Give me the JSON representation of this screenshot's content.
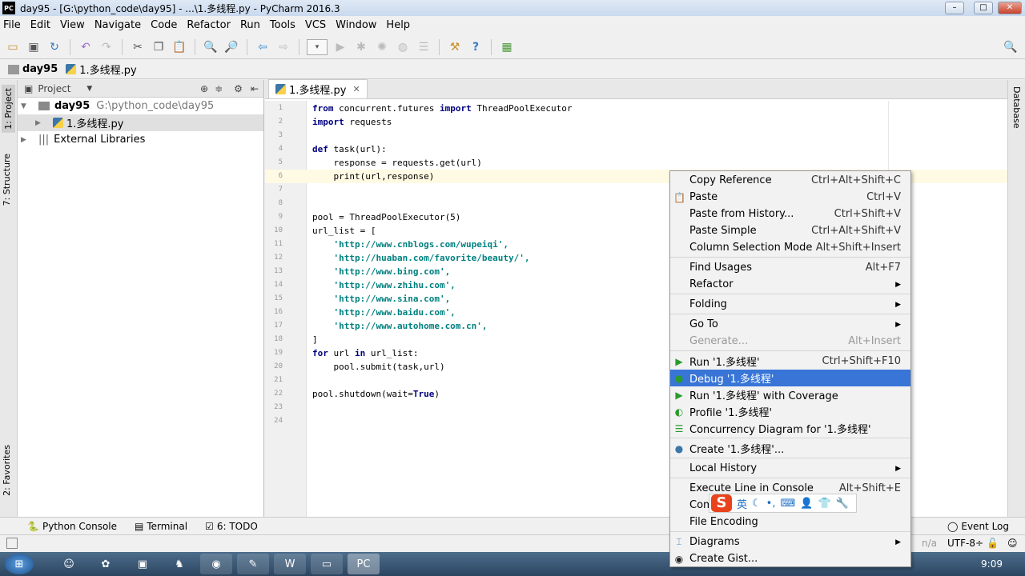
{
  "window": {
    "title": "day95 - [G:\\python_code\\day95] - ...\\1.多线程.py - PyCharm 2016.3",
    "logo": "PC",
    "controls": [
      "minimize",
      "maximize",
      "close"
    ]
  },
  "menubar": [
    "File",
    "Edit",
    "View",
    "Navigate",
    "Code",
    "Refactor",
    "Run",
    "Tools",
    "VCS",
    "Window",
    "Help"
  ],
  "toolbar_icons": [
    "open-folder",
    "save",
    "sync",
    "undo",
    "redo",
    "cut",
    "copy",
    "paste",
    "find",
    "replace",
    "back",
    "forward",
    "run-config-dropdown",
    "run",
    "debug",
    "coverage",
    "profile",
    "concurrency",
    "settings",
    "help",
    "sdk"
  ],
  "breadcrumb": [
    "day95",
    "1.多线程.py"
  ],
  "left_strip": {
    "project": "1: Project",
    "structure": "7: Structure",
    "favorites": "2: Favorites"
  },
  "right_strip": {
    "database": "Database"
  },
  "project": {
    "header": "Project",
    "tree": [
      {
        "name": "day95",
        "path": "G:\\python_code\\day95"
      },
      {
        "name": "1.多线程.py"
      },
      {
        "name": "External Libraries"
      }
    ]
  },
  "editor": {
    "tab": "1.多线程.py",
    "lines": [
      "from concurrent.futures import ThreadPoolExecutor",
      "import requests",
      "",
      "def task(url):",
      "    response = requests.get(url)",
      "    print(url,response)",
      "",
      "",
      "pool = ThreadPoolExecutor(5)",
      "url_list = [",
      "    'http://www.cnblogs.com/wupeiqi',",
      "    'http://huaban.com/favorite/beauty/',",
      "    'http://www.bing.com',",
      "    'http://www.zhihu.com',",
      "    'http://www.sina.com',",
      "    'http://www.baidu.com',",
      "    'http://www.autohome.com.cn',",
      "]",
      "for url in url_list:",
      "    pool.submit(task,url)",
      "",
      "pool.shutdown(wait=True)",
      "",
      ""
    ],
    "current_line": 6
  },
  "context_menu": [
    {
      "label": "Copy Reference",
      "shortcut": "Ctrl+Alt+Shift+C"
    },
    {
      "label": "Paste",
      "shortcut": "Ctrl+V",
      "icon": "paste"
    },
    {
      "label": "Paste from History...",
      "shortcut": "Ctrl+Shift+V"
    },
    {
      "label": "Paste Simple",
      "shortcut": "Ctrl+Alt+Shift+V"
    },
    {
      "label": "Column Selection Mode",
      "shortcut": "Alt+Shift+Insert"
    },
    {
      "sep": true
    },
    {
      "label": "Find Usages",
      "shortcut": "Alt+F7"
    },
    {
      "label": "Refactor",
      "submenu": true
    },
    {
      "sep": true
    },
    {
      "label": "Folding",
      "submenu": true
    },
    {
      "sep": true
    },
    {
      "label": "Go To",
      "submenu": true
    },
    {
      "label": "Generate...",
      "shortcut": "Alt+Insert",
      "disabled": true
    },
    {
      "sep": true
    },
    {
      "label": "Run '1.多线程'",
      "shortcut": "Ctrl+Shift+F10",
      "icon": "run"
    },
    {
      "label": "Debug '1.多线程'",
      "icon": "debug",
      "highlighted": true
    },
    {
      "label": "Run '1.多线程' with Coverage",
      "icon": "coverage"
    },
    {
      "label": "Profile '1.多线程'",
      "icon": "profile"
    },
    {
      "label": "Concurrency Diagram for  '1.多线程'",
      "icon": "concurrency"
    },
    {
      "sep": true
    },
    {
      "label": "Create '1.多线程'...",
      "icon": "python"
    },
    {
      "sep": true
    },
    {
      "label": "Local History",
      "submenu": true
    },
    {
      "sep": true
    },
    {
      "label": "Execute Line in Console",
      "shortcut": "Alt+Shift+E"
    },
    {
      "label": "Com"
    },
    {
      "label": "File Encoding"
    },
    {
      "sep": true
    },
    {
      "label": "Diagrams",
      "submenu": true,
      "icon": "diagram"
    },
    {
      "label": "Create Gist...",
      "icon": "github"
    }
  ],
  "ime_toolbar": {
    "logo": "S",
    "mode": "英"
  },
  "bottom_tabs": [
    "Python Console",
    "Terminal",
    "6: TODO"
  ],
  "event_log": "Event Log",
  "status": {
    "position": "n/a",
    "encoding": "UTF-8÷"
  },
  "taskbar": {
    "clock": "9:09"
  },
  "colors": {
    "highlight": "#3875d7",
    "keyword": "#000080",
    "string": "#008080"
  }
}
